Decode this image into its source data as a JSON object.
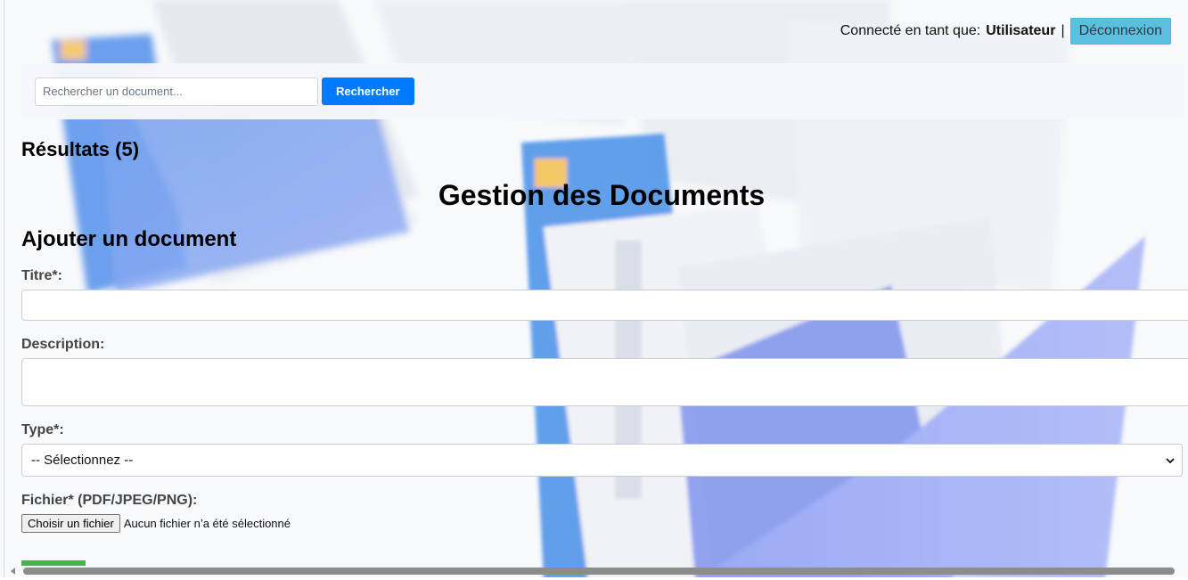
{
  "user_bar": {
    "prefix": "Connecté en tant que:",
    "username": "Utilisateur",
    "separator": "|",
    "logout_label": "Déconnexion"
  },
  "search": {
    "placeholder": "Rechercher un document...",
    "value": "",
    "button_label": "Rechercher"
  },
  "results": {
    "title": "Résultats (5)"
  },
  "page": {
    "title": "Gestion des Documents"
  },
  "form": {
    "section_title": "Ajouter un document",
    "title_label": "Titre*:",
    "title_value": "",
    "description_label": "Description:",
    "description_value": "",
    "type_label": "Type*:",
    "type_selected": "-- Sélectionnez --",
    "file_label": "Fichier* (PDF/JPEG/PNG):",
    "file_button_label": "Choisir un fichier",
    "file_status": "Aucun fichier n’a été sélectionné"
  },
  "colors": {
    "logout_button": "#5bc0de",
    "search_button": "#007bff",
    "submit_button": "#4caf50"
  },
  "icons": {
    "select_chevron": "chevron-down-icon",
    "scroll_left": "scroll-left-arrow-icon"
  }
}
